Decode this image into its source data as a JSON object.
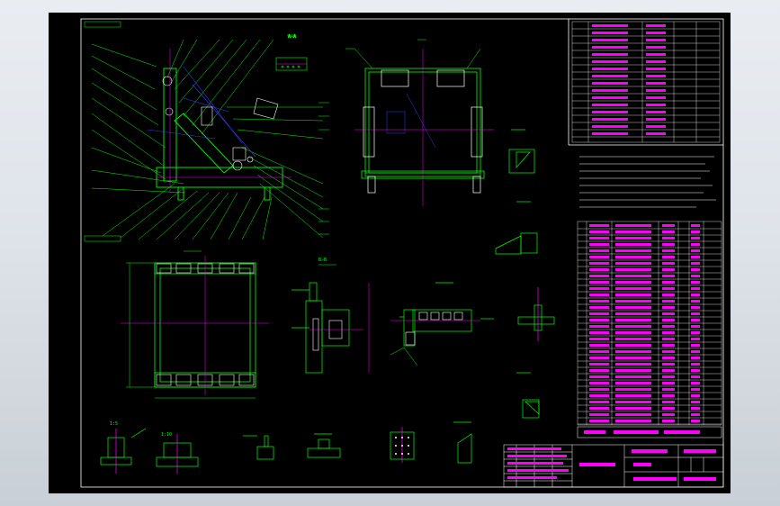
{
  "colors": {
    "background": "#000000",
    "frame": "#ffffff",
    "part_outline": "#ffffff",
    "structure": "#00ff00",
    "dimension": "#00ff00",
    "centerline": "#ff00ff",
    "hidden": "#3a3aff",
    "annotation": "#00ffff",
    "table_text": "#ff00ff",
    "table_line": "#ffffff"
  },
  "drawing": {
    "view_tags": [
      "A-A",
      "B-B",
      "1:5",
      "1:10"
    ]
  }
}
